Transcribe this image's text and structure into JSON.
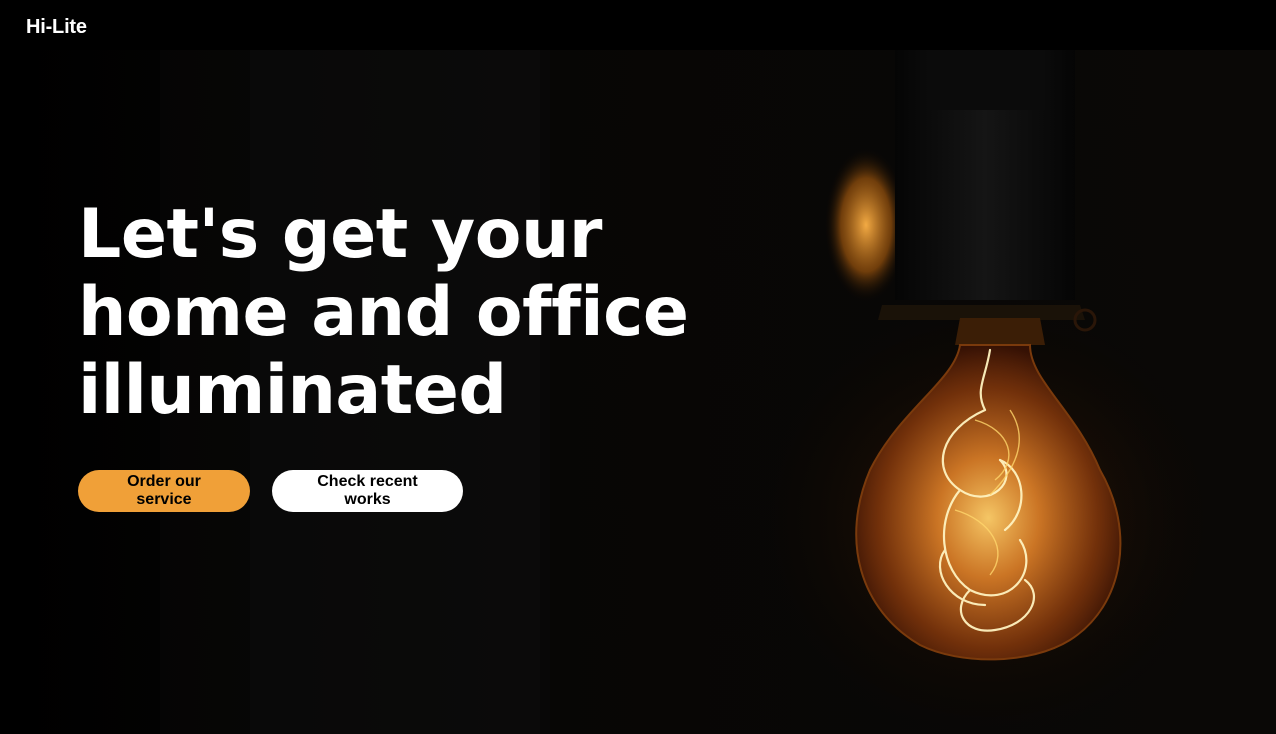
{
  "brand": {
    "logo_text": "Hi-Lite"
  },
  "hero": {
    "headline": "Let's get your home and office illuminated",
    "primary_cta": "Order our service",
    "secondary_cta": "Check recent works"
  },
  "colors": {
    "background": "#000000",
    "accent": "#f0a038",
    "text": "#ffffff",
    "bulb_glow": "#ffb347"
  },
  "icons": [
    "light-bulb-image"
  ]
}
